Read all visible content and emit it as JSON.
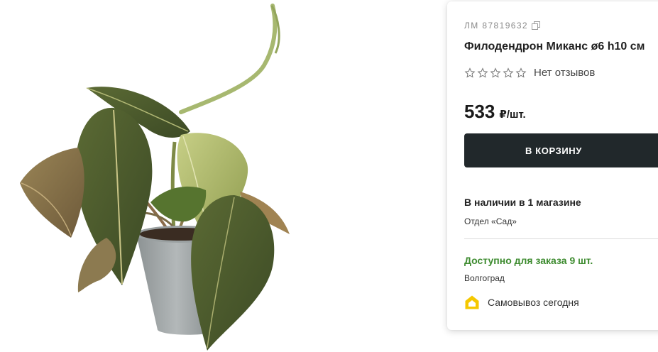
{
  "product": {
    "article": "ЛМ 87819632",
    "title": "Филодендрон Миканс ø6 h10 см",
    "rating_stars": 0,
    "reviews_text": "Нет отзывов",
    "price_value": "533",
    "price_unit": "₽/шт.",
    "add_to_cart_label": "В КОРЗИНУ"
  },
  "availability": {
    "stock_title": "В наличии в 1 магазине",
    "department": "Отдел «Сад»",
    "order_title": "Доступно для заказа 9 шт.",
    "city": "Волгоград",
    "pickup_label": "Самовывоз сегодня"
  },
  "colors": {
    "button_bg": "#21282b",
    "availability_green": "#3d8b2f",
    "pickup_icon": "#f5c800"
  },
  "icons": {
    "copy": "copy-icon",
    "star": "star-outline-icon",
    "pickup": "house-pickup-icon"
  }
}
